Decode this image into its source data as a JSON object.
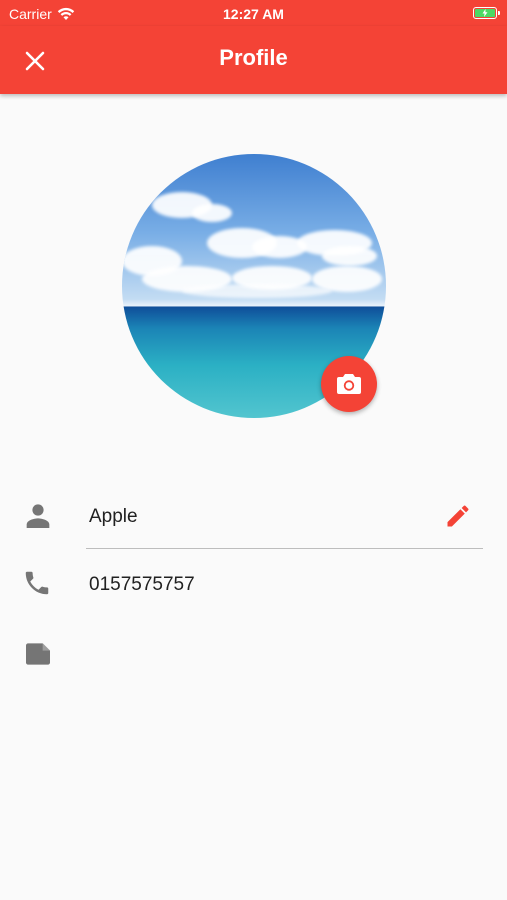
{
  "status_bar": {
    "carrier": "Carrier",
    "time": "12:27 AM",
    "battery_color": "#4cd964"
  },
  "app_bar": {
    "title": "Profile",
    "close_icon": "close-icon",
    "color": "#f44336"
  },
  "profile": {
    "photo_description_icon": "ocean-photo",
    "camera_icon": "camera-icon"
  },
  "fields": {
    "name": {
      "icon": "person-icon",
      "value": "Apple",
      "edit_icon": "pencil-icon"
    },
    "phone": {
      "icon": "phone-icon",
      "value": "0157575757"
    },
    "note": {
      "icon": "note-icon",
      "value": ""
    }
  },
  "colors": {
    "accent": "#f44336",
    "icon_gray": "#757575",
    "background": "#fafafa"
  }
}
